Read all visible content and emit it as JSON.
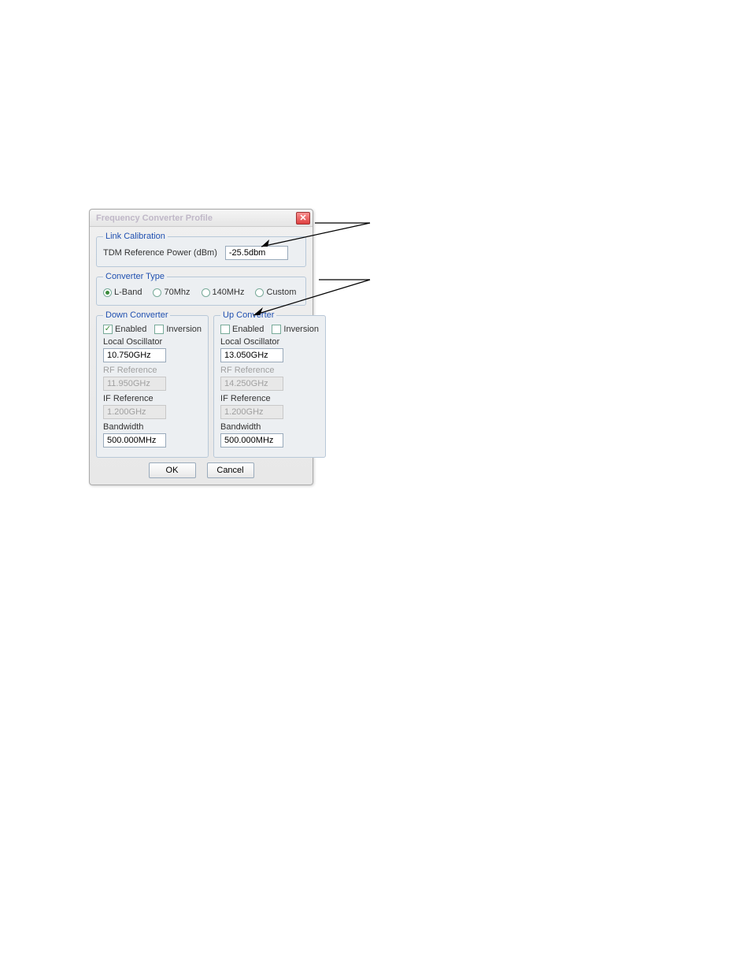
{
  "dialog": {
    "title": "Frequency Converter Profile"
  },
  "link_calibration": {
    "legend": "Link Calibration",
    "tdm_label": "TDM Reference Power (dBm)",
    "tdm_value": "-25.5dbm"
  },
  "converter_type": {
    "legend": "Converter Type",
    "options": {
      "lband": "L-Band",
      "seventy": "70Mhz",
      "onefourty": "140MHz",
      "custom": "Custom"
    },
    "selected": "lband"
  },
  "down_converter": {
    "legend": "Down Converter",
    "enabled_label": "Enabled",
    "enabled_checked": true,
    "inversion_label": "Inversion",
    "inversion_checked": false,
    "local_oscillator_label": "Local Oscillator",
    "local_oscillator_value": "10.750GHz",
    "rf_reference_label": "RF Reference",
    "rf_reference_value": "11.950GHz",
    "if_reference_label": "IF Reference",
    "if_reference_value": "1.200GHz",
    "bandwidth_label": "Bandwidth",
    "bandwidth_value": "500.000MHz"
  },
  "up_converter": {
    "legend": "Up Converter",
    "enabled_label": "Enabled",
    "enabled_checked": false,
    "inversion_label": "Inversion",
    "inversion_checked": false,
    "local_oscillator_label": "Local Oscillator",
    "local_oscillator_value": "13.050GHz",
    "rf_reference_label": "RF Reference",
    "rf_reference_value": "14.250GHz",
    "if_reference_label": "IF Reference",
    "if_reference_value": "1.200GHz",
    "bandwidth_label": "Bandwidth",
    "bandwidth_value": "500.000MHz"
  },
  "buttons": {
    "ok": "OK",
    "cancel": "Cancel"
  }
}
